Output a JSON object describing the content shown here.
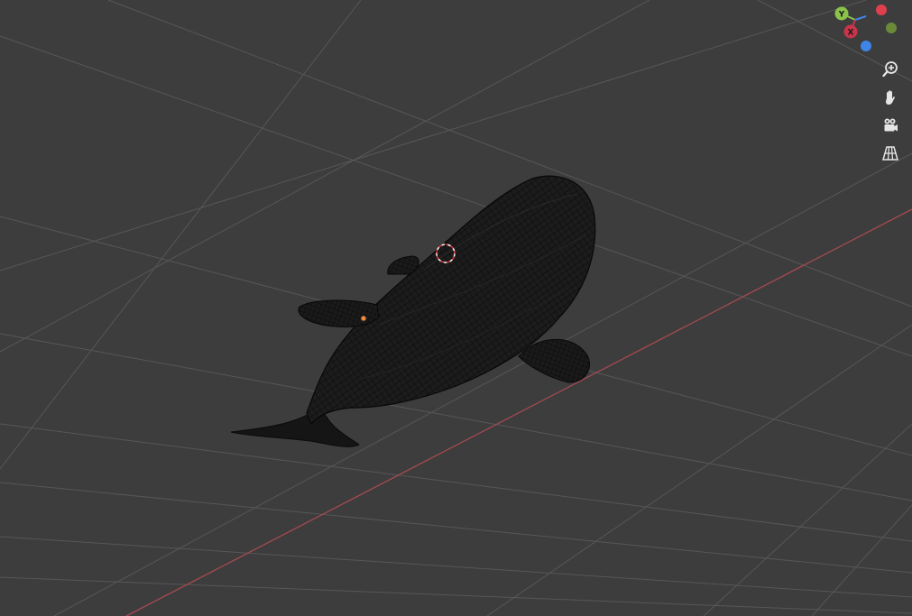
{
  "viewport": {
    "background_color": "#3d3d3d",
    "grid_color": "#5a5a5a",
    "x_axis_color": "#a64a52"
  },
  "gizmo": {
    "axes": [
      {
        "label": "Y",
        "color": "#8bc34a"
      },
      {
        "label": "X",
        "color": "#c8344a"
      },
      {
        "label": "",
        "color": "#e0404e"
      },
      {
        "label": "",
        "color": "#6a8a3a"
      },
      {
        "label": "",
        "color": "#3f85e8"
      }
    ]
  },
  "navigation": {
    "buttons": [
      {
        "icon": "zoom-icon"
      },
      {
        "icon": "hand-pan-icon"
      },
      {
        "icon": "camera-icon"
      },
      {
        "icon": "grid-perspective-icon"
      }
    ]
  },
  "scene": {
    "object": "whale-mesh",
    "display_mode": "wireframe",
    "mesh_color": "#111111"
  }
}
